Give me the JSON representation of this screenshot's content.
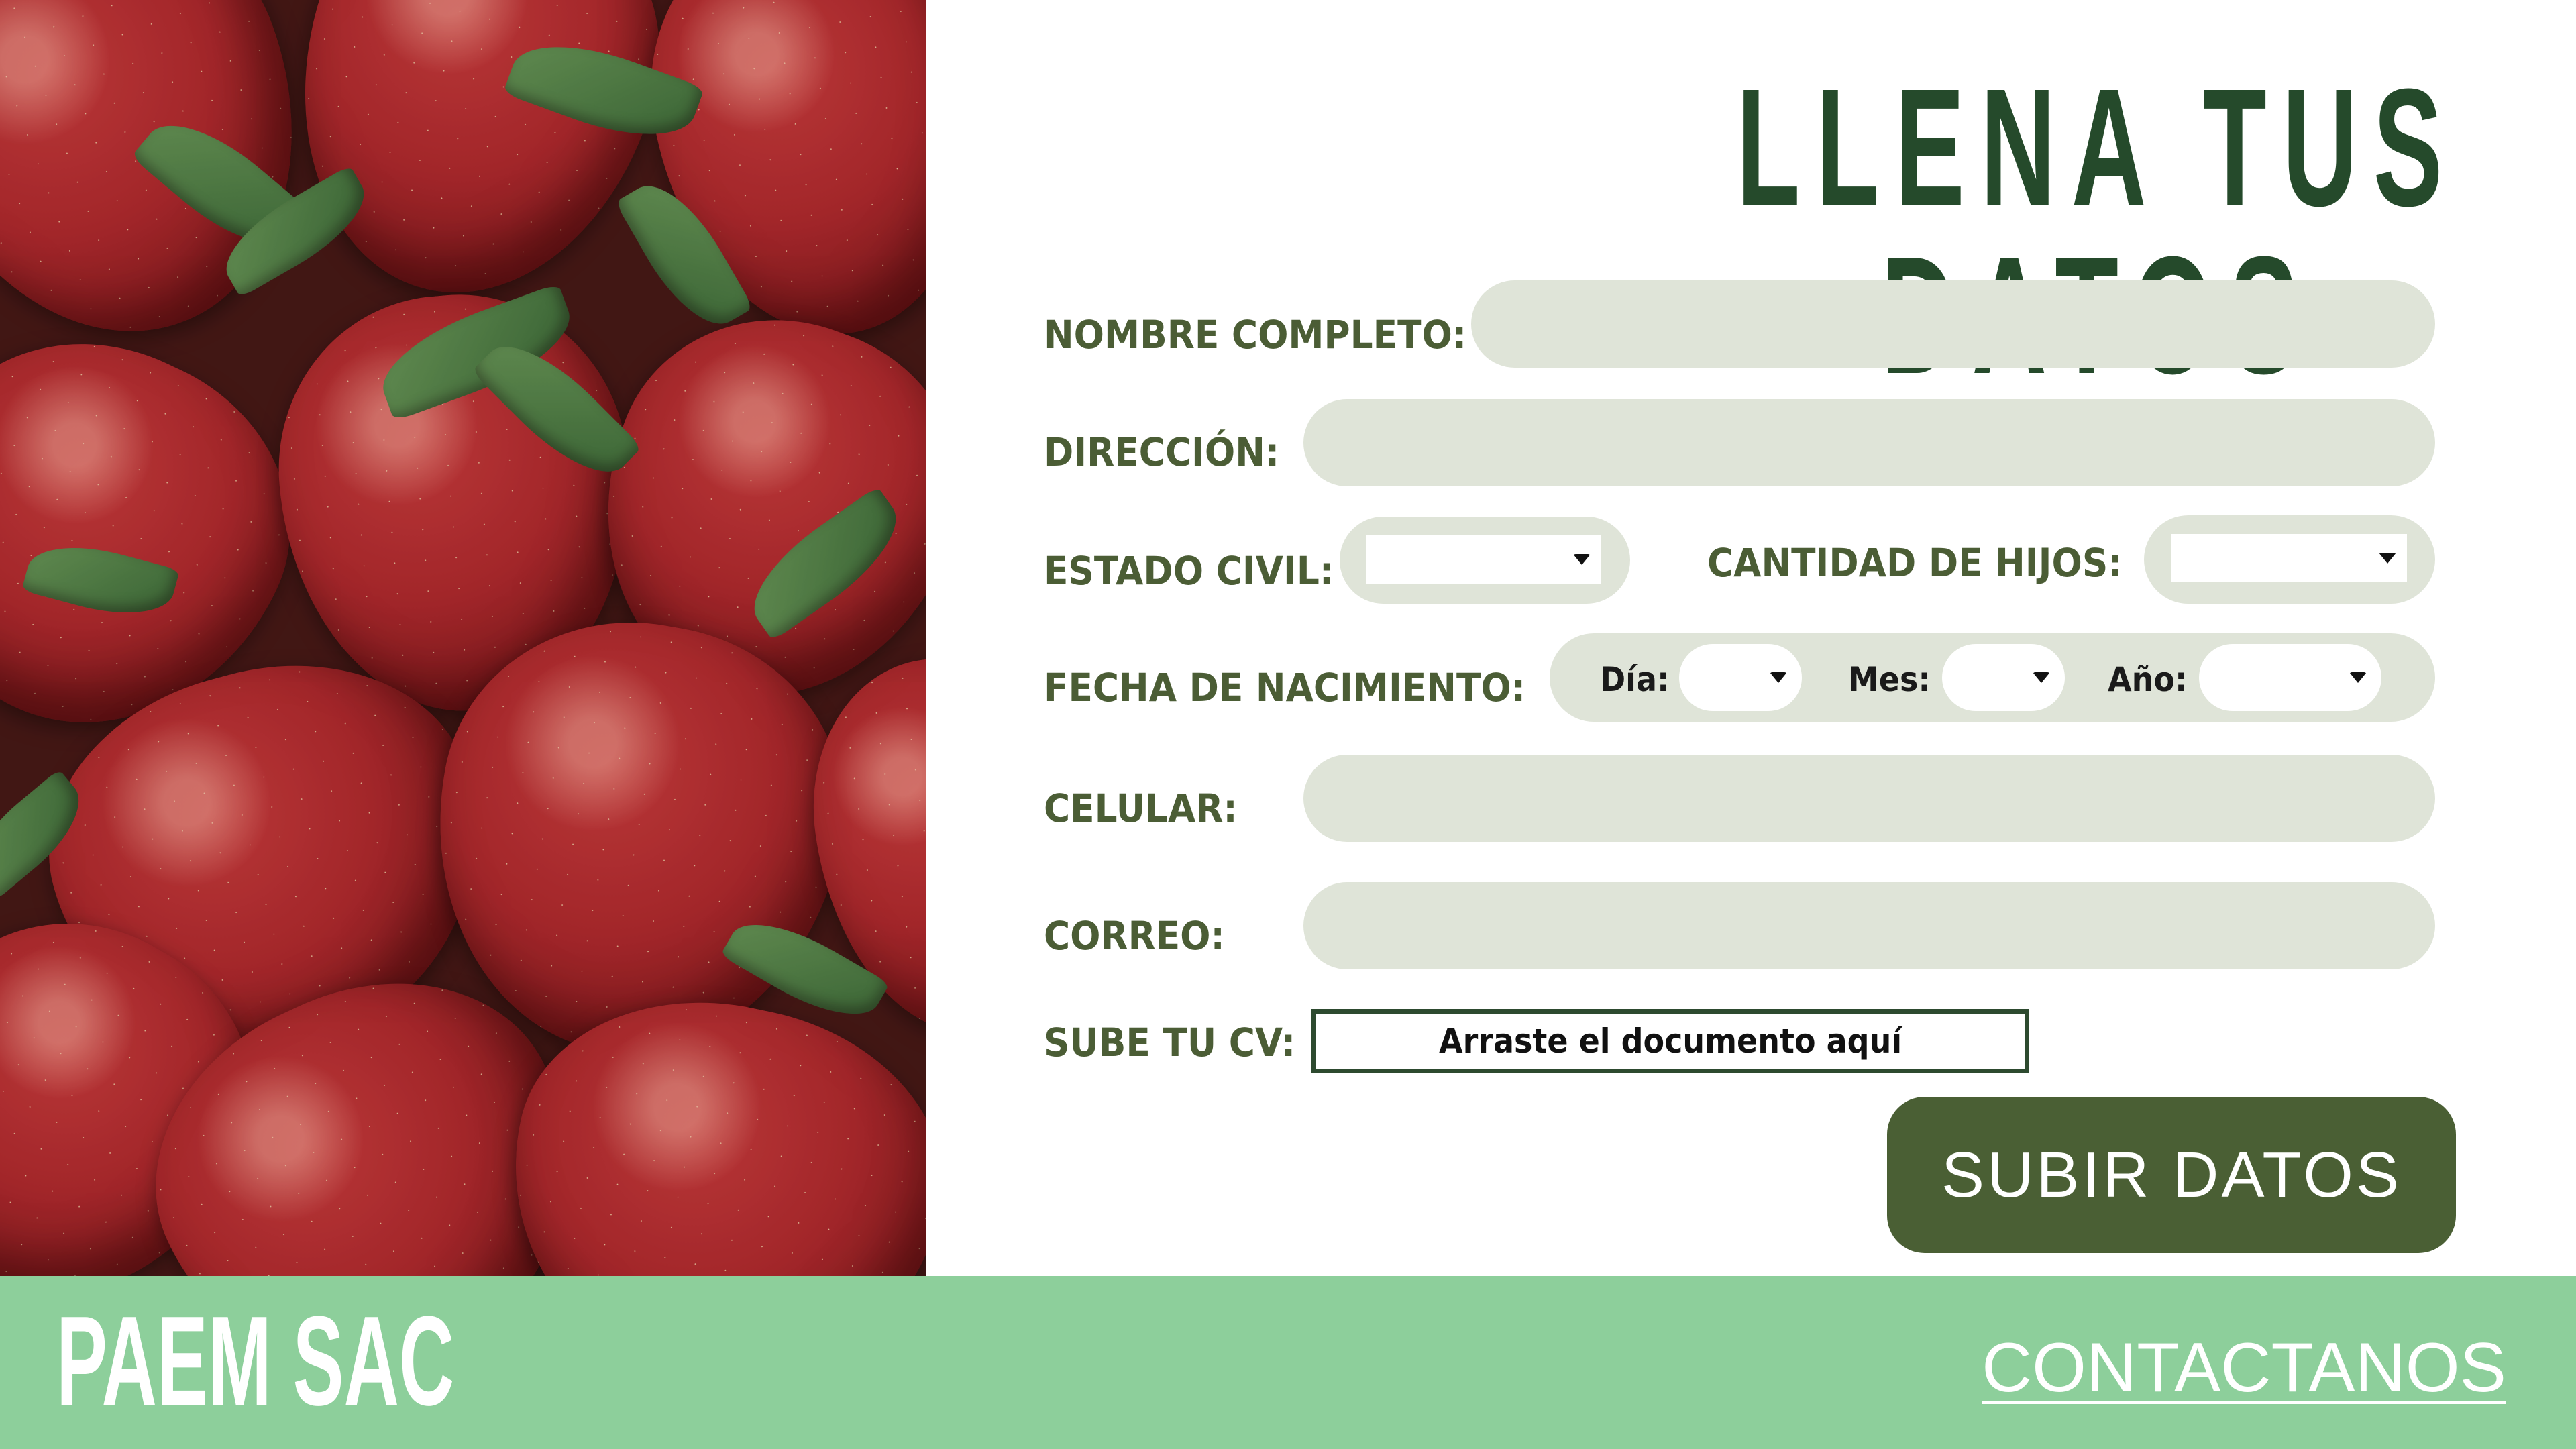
{
  "form": {
    "title": "LLENA TUS DATOS",
    "labels": {
      "nombre": "NOMBRE COMPLETO:",
      "direccion": "DIRECCIÓN:",
      "estado_civil": "ESTADO CIVIL:",
      "cantidad_hijos": "CANTIDAD DE HIJOS:",
      "fecha_nacimiento": "FECHA DE NACIMIENTO:",
      "celular": "CELULAR:",
      "correo": "CORREO:",
      "cv": "SUBE TU CV:"
    },
    "date_parts": {
      "dia": "Día:",
      "mes": "Mes:",
      "anio": "Año:"
    },
    "dropzone_text": "Arraste el documento aquí",
    "submit_label": "SUBIR DATOS"
  },
  "footer": {
    "brand": "PAEM SAC",
    "contact_link": "CONTACTANOS"
  },
  "colors": {
    "title": "#254a2b",
    "label": "#4b5d35",
    "field_bg": "#dfe4d8",
    "submit_bg": "#4a5f34",
    "footer_bg": "#8dcf9b"
  }
}
